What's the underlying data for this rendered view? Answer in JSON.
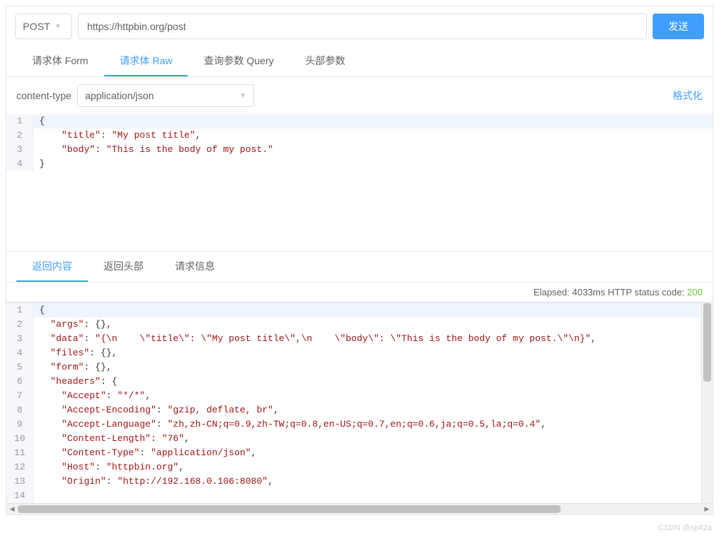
{
  "request": {
    "method": "POST",
    "url": "https://httpbin.org/post",
    "send_label": "发送"
  },
  "tabs_request": {
    "form": "请求体 Form",
    "raw": "请求体 Raw",
    "query": "查询参数 Query",
    "headers": "头部参数"
  },
  "content_type": {
    "label": "content-type",
    "value": "application/json",
    "format_link": "格式化"
  },
  "request_body": {
    "lines": [
      "{",
      "    \"title\": \"My post title\",",
      "    \"body\": \"This is the body of my post.\"",
      "}"
    ]
  },
  "tabs_response": {
    "content": "返回内容",
    "headers": "返回头部",
    "request_info": "请求信息"
  },
  "status": {
    "elapsed_label": "Elapsed:",
    "elapsed_value": "4033ms",
    "code_label": "HTTP status code:",
    "code_value": "200"
  },
  "response_body": {
    "lines": [
      "{",
      "  \"args\": {},",
      "  \"data\": \"{\\n    \\\"title\\\": \\\"My post title\\\",\\n    \\\"body\\\": \\\"This is the body of my post.\\\"\\n}\",",
      "  \"files\": {},",
      "  \"form\": {},",
      "  \"headers\": {",
      "    \"Accept\": \"*/*\",",
      "    \"Accept-Encoding\": \"gzip, deflate, br\",",
      "    \"Accept-Language\": \"zh,zh-CN;q=0.9,zh-TW;q=0.8,en-US;q=0.7,en;q=0.6,ja;q=0.5,la;q=0.4\",",
      "    \"Content-Length\": \"76\",",
      "    \"Content-Type\": \"application/json\",",
      "    \"Host\": \"httpbin.org\",",
      "    \"Origin\": \"http://192.168.0.106:8080\",",
      ""
    ]
  },
  "watermark": "CSDN @sp42a"
}
